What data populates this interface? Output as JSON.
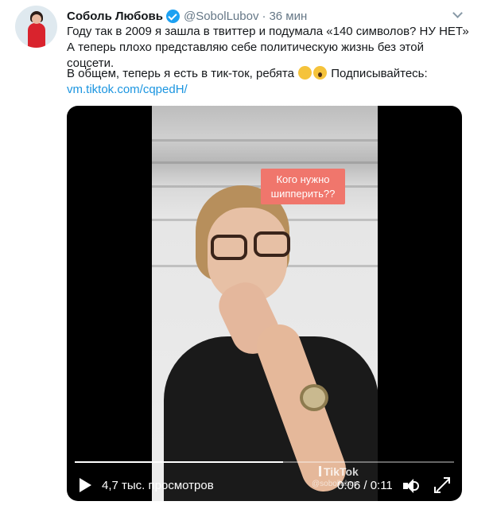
{
  "author": {
    "name": "Соболь Любовь",
    "handle": "@SobolLubov",
    "separator": "·",
    "time": "36 мин",
    "verified_icon": "verified-badge-icon"
  },
  "tweet": {
    "paragraph1": "Году так в 2009 я зашла в твиттер и подумала «140 символов? НУ НЕТ» А теперь плохо представляю себе политическую жизнь без этой соцсети.",
    "paragraph2_text": "В общем, теперь я есть в тик-ток, ребята",
    "paragraph2_after": "Подписывайтесь:",
    "emojis": [
      "waving-hands-emoji",
      "screaming-face-emoji"
    ],
    "link": "vm.tiktok.com/cqpedH/"
  },
  "video": {
    "sticker_line1": "Кого нужно",
    "sticker_line2": "шипперить??",
    "views": "4,7 тыс. просмотров",
    "watermark": "TikTok",
    "watermark_user": "@sobollubov",
    "timer": "0:06 / 0:11",
    "progress": 0.55,
    "colors": {
      "sticker": "#f0766c",
      "link": "#1b95e0",
      "verified": "#1da1f2"
    }
  }
}
